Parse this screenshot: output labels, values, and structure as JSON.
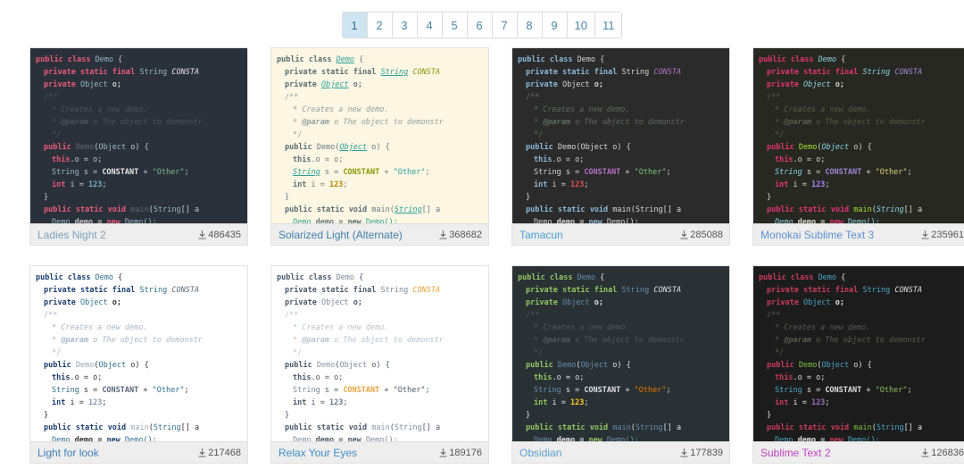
{
  "pagination": {
    "pages": [
      "1",
      "2",
      "3",
      "4",
      "5",
      "6",
      "7",
      "8",
      "9",
      "10",
      "11"
    ],
    "active": "1"
  },
  "download_icon": "download-icon",
  "code_lines": {
    "l1": "public class Demo {",
    "l2": "private static final String CONSTA",
    "l3": "private Object o;",
    "l4": "/**",
    "l5": "* Creates a new demo.",
    "l6": "* @param o The object to demonstr",
    "l7": "*/",
    "l8": "public Demo(Object o) {",
    "l9": "this.o = o;",
    "l10": "String s = CONSTANT + \"Other\";",
    "l11": "int i = 123;",
    "l12": "}",
    "l13": "public static void main(String[] a",
    "l14": "Demo demo = new Demo();"
  },
  "tokens": {
    "public": "public",
    "class": "class",
    "Demo": "Demo",
    "brace_open": "{",
    "brace_close": "}",
    "private": "private",
    "static": "static",
    "final": "final",
    "String": "String",
    "CONSTA": "CONSTA",
    "Object": "Object",
    "o_semi": "o;",
    "comment_open": "/**",
    "comment_creates": "* Creates a new demo.",
    "comment_param_star": "* ",
    "comment_param_tag": "@param",
    "comment_param_rest": " o The object to demonstr",
    "comment_close": "*/",
    "demo_ctor": "Demo",
    "paren_open": "(",
    "paren_o_close": " o) {",
    "this": "this",
    "dot_o_eq_o": ".o = o;",
    "s_eq": " s = ",
    "CONSTANT": "CONSTANT",
    "plus": " + ",
    "other_str": "\"Other\"",
    "semi": ";",
    "int": "int",
    "i_eq": " i = ",
    "num123": "123",
    "void": "void",
    "main": "main",
    "bracket_a": "[] a",
    "demo_var": " demo = ",
    "new": "new",
    "demo_call": "Demo();"
  },
  "themes": [
    {
      "name": "Ladies Night 2",
      "downloads": "486435",
      "visited": false,
      "colors": {
        "bg": "#2b313a",
        "text": "#c5c8c6",
        "keyword": "#e85a7a",
        "type": "#9ab8c2",
        "comment": "#4a545f",
        "string": "#79b88c",
        "number": "#6fb3c7",
        "constant": "#e6e6e6",
        "func": "#5c6670",
        "name": "#7f9fb8"
      }
    },
    {
      "name": "Solarized Light (Alternate)",
      "downloads": "368682",
      "visited": false,
      "colors": {
        "bg": "#fdf6e3",
        "text": "#657b83",
        "keyword": "#586e75",
        "type": "#2aa198",
        "comment": "#93a1a1",
        "string": "#2aa198",
        "number": "#b58900",
        "constant": "#859900",
        "func": "#657b83",
        "name": "#3f7fa8"
      }
    },
    {
      "name": "Tamacun",
      "downloads": "285088",
      "visited": false,
      "colors": {
        "bg": "#2b2b2b",
        "text": "#d6d6d6",
        "keyword": "#8ab8d8",
        "type": "#d6d6d6",
        "comment": "#5c6e5c",
        "string": "#7bc47b",
        "number": "#d9534f",
        "constant": "#b570c4",
        "func": "#d6d6d6",
        "name": "#4a9fd4"
      }
    },
    {
      "name": "Monokai Sublime Text 3",
      "downloads": "235961",
      "visited": false,
      "colors": {
        "bg": "#272822",
        "text": "#d8d8d2",
        "keyword": "#e0356e",
        "type": "#8ad4e0",
        "comment": "#5a5a4a",
        "string": "#e0d47a",
        "number": "#ae81ff",
        "constant": "#9c88d4",
        "func": "#a6e22e",
        "name": "#5b8fd0"
      }
    },
    {
      "name": "Light for look",
      "downloads": "217468",
      "visited": false,
      "colors": {
        "bg": "#ffffff",
        "text": "#333333",
        "keyword": "#1a3e6e",
        "type": "#2e6e8e",
        "comment": "#a8b8c8",
        "string": "#2e6e8e",
        "number": "#8a9aa8",
        "constant": "#5a6a7a",
        "func": "#9aa8b6",
        "name": "#3f7fb8"
      }
    },
    {
      "name": "Relax Your Eyes",
      "downloads": "189176",
      "visited": false,
      "colors": {
        "bg": "#ffffff",
        "text": "#4a5a6a",
        "keyword": "#4a5a6a",
        "type": "#7a8a9a",
        "comment": "#b8c4ce",
        "string": "#4a5a6a",
        "number": "#6a7a8a",
        "constant": "#e8a33d",
        "func": "#8a98a6",
        "name": "#3f8fc4"
      }
    },
    {
      "name": "Obsidian",
      "downloads": "177839",
      "visited": false,
      "colors": {
        "bg": "#293134",
        "text": "#e0e2e4",
        "keyword": "#93c763",
        "type": "#678cb1",
        "comment": "#52585c",
        "string": "#ec7600",
        "number": "#ffcd22",
        "constant": "#e0e2e4",
        "func": "#678cb1",
        "name": "#5a9fd0"
      }
    },
    {
      "name": "Sublime Text 2",
      "downloads": "126836",
      "visited": true,
      "colors": {
        "bg": "#1c1c1c",
        "text": "#e0e0e0",
        "keyword": "#c93c5c",
        "type": "#4aa8c4",
        "comment": "#5a5a52",
        "string": "#8fbf5f",
        "number": "#9c6fc4",
        "constant": "#e0e0e0",
        "func": "#7fbf3f",
        "name": "#c13fc1"
      }
    }
  ]
}
